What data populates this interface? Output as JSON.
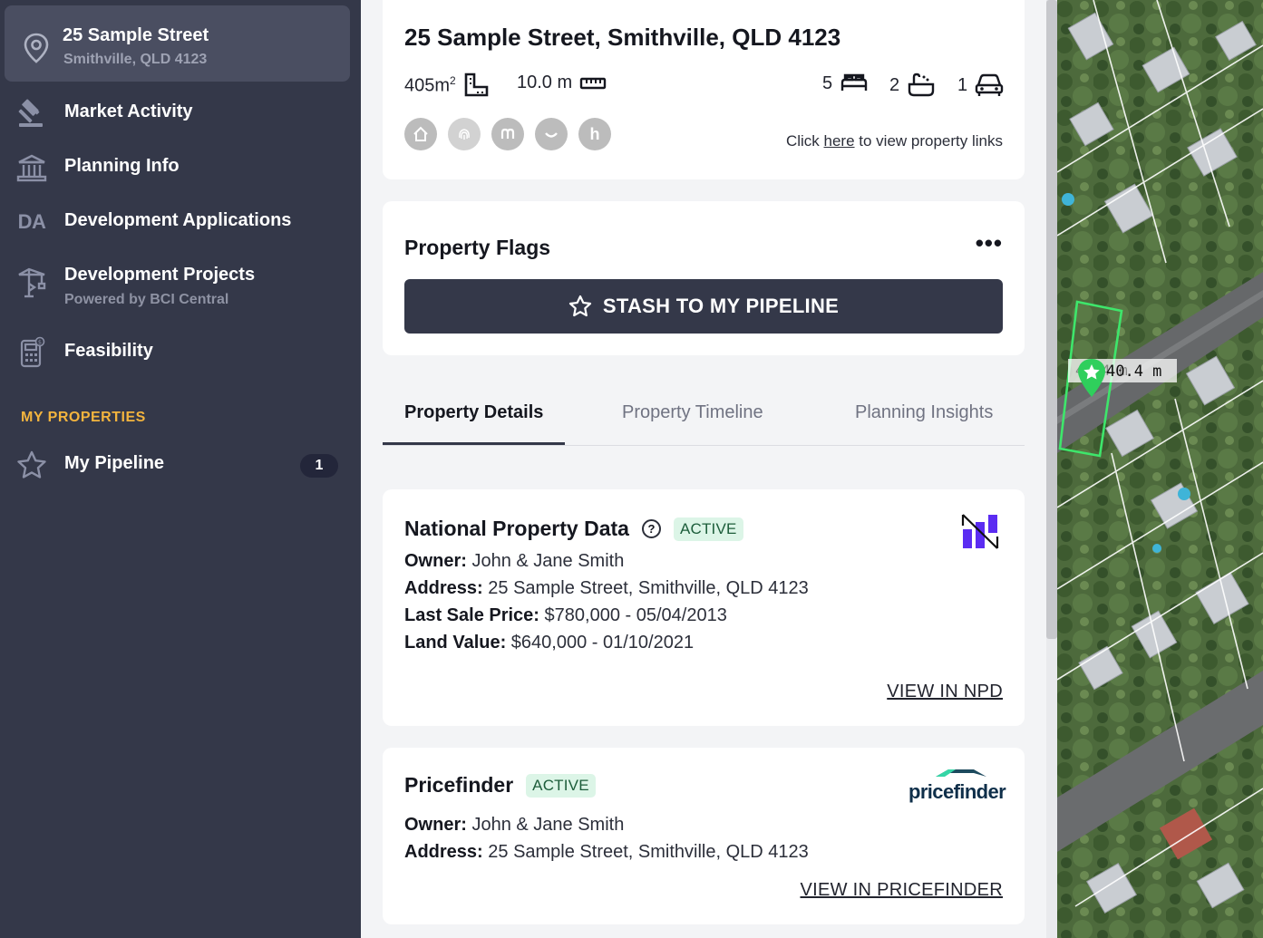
{
  "sidebar": {
    "address_line1": "25 Sample Street",
    "address_line2": "Smithville, QLD 4123",
    "items": [
      {
        "label": "Market Activity",
        "icon": "gavel-icon"
      },
      {
        "label": "Planning Info",
        "icon": "building-columns-icon"
      },
      {
        "label": "Development Applications",
        "icon": "da-icon",
        "icon_text": "DA"
      },
      {
        "label": "Development Projects",
        "sub": "Powered by BCI Central",
        "icon": "crane-icon"
      },
      {
        "label": "Feasibility",
        "icon": "calculator-icon"
      }
    ],
    "section_title": "MY PROPERTIES",
    "pipeline": {
      "label": "My Pipeline",
      "count": "1"
    }
  },
  "summary": {
    "title": "25 Sample Street, Smithville, QLD 4123",
    "land_area": "405m",
    "land_area_sup": "2",
    "frontage": "10.0 m",
    "bedrooms": "5",
    "bathrooms": "2",
    "car_spaces": "1",
    "links_prefix": "Click ",
    "links_link": "here",
    "links_suffix": " to view property links",
    "link_icons": [
      "h"
    ]
  },
  "flags": {
    "title": "Property Flags",
    "menu": "•••",
    "stash_label": "STASH TO MY PIPELINE"
  },
  "tabs": [
    "Property Details",
    "Property Timeline",
    "Planning Insights"
  ],
  "npd": {
    "title": "National Property Data",
    "badge": "ACTIVE",
    "owner_label": "Owner:",
    "owner": " John & Jane Smith",
    "address_label": "Address:",
    "address": " 25 Sample Street, Smithville, QLD 4123",
    "last_sale_label": "Last Sale Price:",
    "last_sale": " $780,000 - 05/04/2013",
    "land_value_label": "Land Value:",
    "land_value": " $640,000 - 01/10/2021",
    "link": "VIEW IN NPD"
  },
  "pricefinder": {
    "title": "Pricefinder",
    "badge": "ACTIVE",
    "logo_text": "pricefinder",
    "owner_label": "Owner:",
    "owner": " John & Jane Smith",
    "address_label": "Address:",
    "address": " 25 Sample Street, Smithville, QLD 4123",
    "link": "VIEW IN PRICEFINDER"
  },
  "map": {
    "measurement": "40.4 m",
    "measurement_ghost": "4 .4 m"
  },
  "colors": {
    "sidebar_bg": "#343849",
    "accent_gold": "#f3b43e",
    "active_badge_bg": "#dcf5e7",
    "parcel_green": "#3ee66b"
  }
}
